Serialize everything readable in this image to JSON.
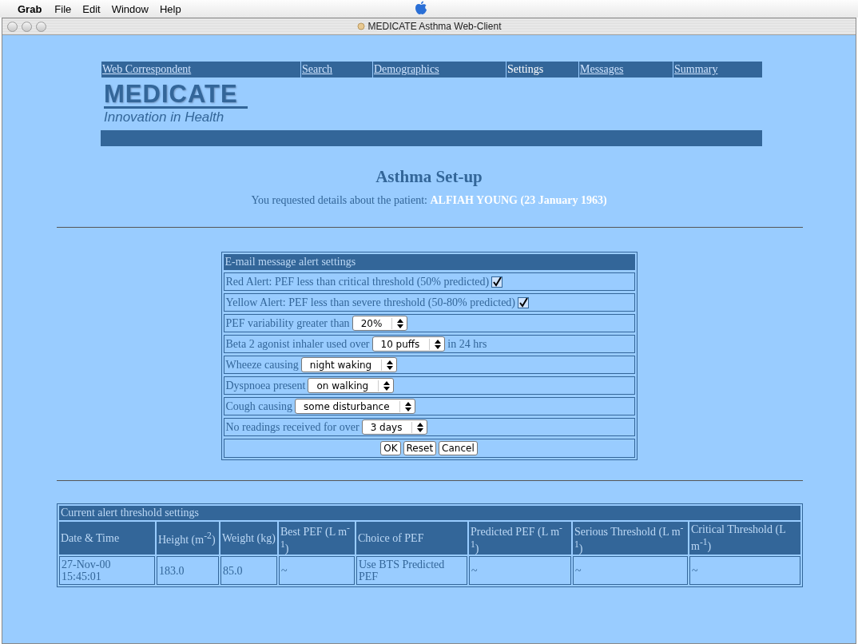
{
  "menu_bar": {
    "app": "Grab",
    "items": [
      "File",
      "Edit",
      "Window",
      "Help"
    ]
  },
  "window": {
    "title": "MEDICATE Asthma Web-Client"
  },
  "nav": [
    {
      "label": "Web Correspondent",
      "selected": false
    },
    {
      "label": "Search",
      "selected": false
    },
    {
      "label": "Demographics",
      "selected": false
    },
    {
      "label": "Settings",
      "selected": true
    },
    {
      "label": "Messages",
      "selected": false
    },
    {
      "label": "Summary",
      "selected": false
    }
  ],
  "logo": {
    "name": "MEDICATE",
    "tagline": "Innovation in Health"
  },
  "heading": "Asthma Set-up",
  "patient": {
    "prefix": "You requested details about the patient:",
    "name": "ALFIAH YOUNG (23 January 1963)"
  },
  "alert_settings": {
    "title": "E-mail message alert settings",
    "rows": [
      {
        "kind": "checkbox",
        "label": "Red Alert: PEF less than critical threshold (50% predicted)",
        "checked": true
      },
      {
        "kind": "checkbox",
        "label": "Yellow Alert: PEF less than severe threshold (50-80% predicted)",
        "checked": true
      },
      {
        "kind": "select",
        "label": "PEF variability greater than",
        "value": "20%"
      },
      {
        "kind": "select",
        "label": "Beta 2 agonist inhaler used over",
        "value": "10 puffs",
        "suffix": "in 24 hrs"
      },
      {
        "kind": "select",
        "label": "Wheeze causing",
        "value": "night waking"
      },
      {
        "kind": "select",
        "label": "Dyspnoea present",
        "value": "on walking"
      },
      {
        "kind": "select",
        "label": "Cough causing",
        "value": "some disturbance"
      },
      {
        "kind": "select",
        "label": "No readings received for over",
        "value": "3 days"
      }
    ],
    "buttons": [
      "OK",
      "Reset",
      "Cancel"
    ]
  },
  "thresholds": {
    "title": "Current alert threshold settings",
    "columns": [
      "Date & Time",
      "Height (m$^{-2}$)",
      "Weight (kg)",
      "Best PEF (L m$^{-1}$)",
      "Choice of PEF",
      "Predicted PEF (L m$^{-1}$)",
      "Serious Threshold (L m$^{-1}$)",
      "Critical Threshold (L m$^{-1}$)"
    ],
    "rows": [
      [
        "27-Nov-00 15:45:01",
        "183.0",
        "85.0",
        "~",
        "Use BTS Predicted PEF",
        "~",
        "~",
        "~"
      ]
    ]
  }
}
